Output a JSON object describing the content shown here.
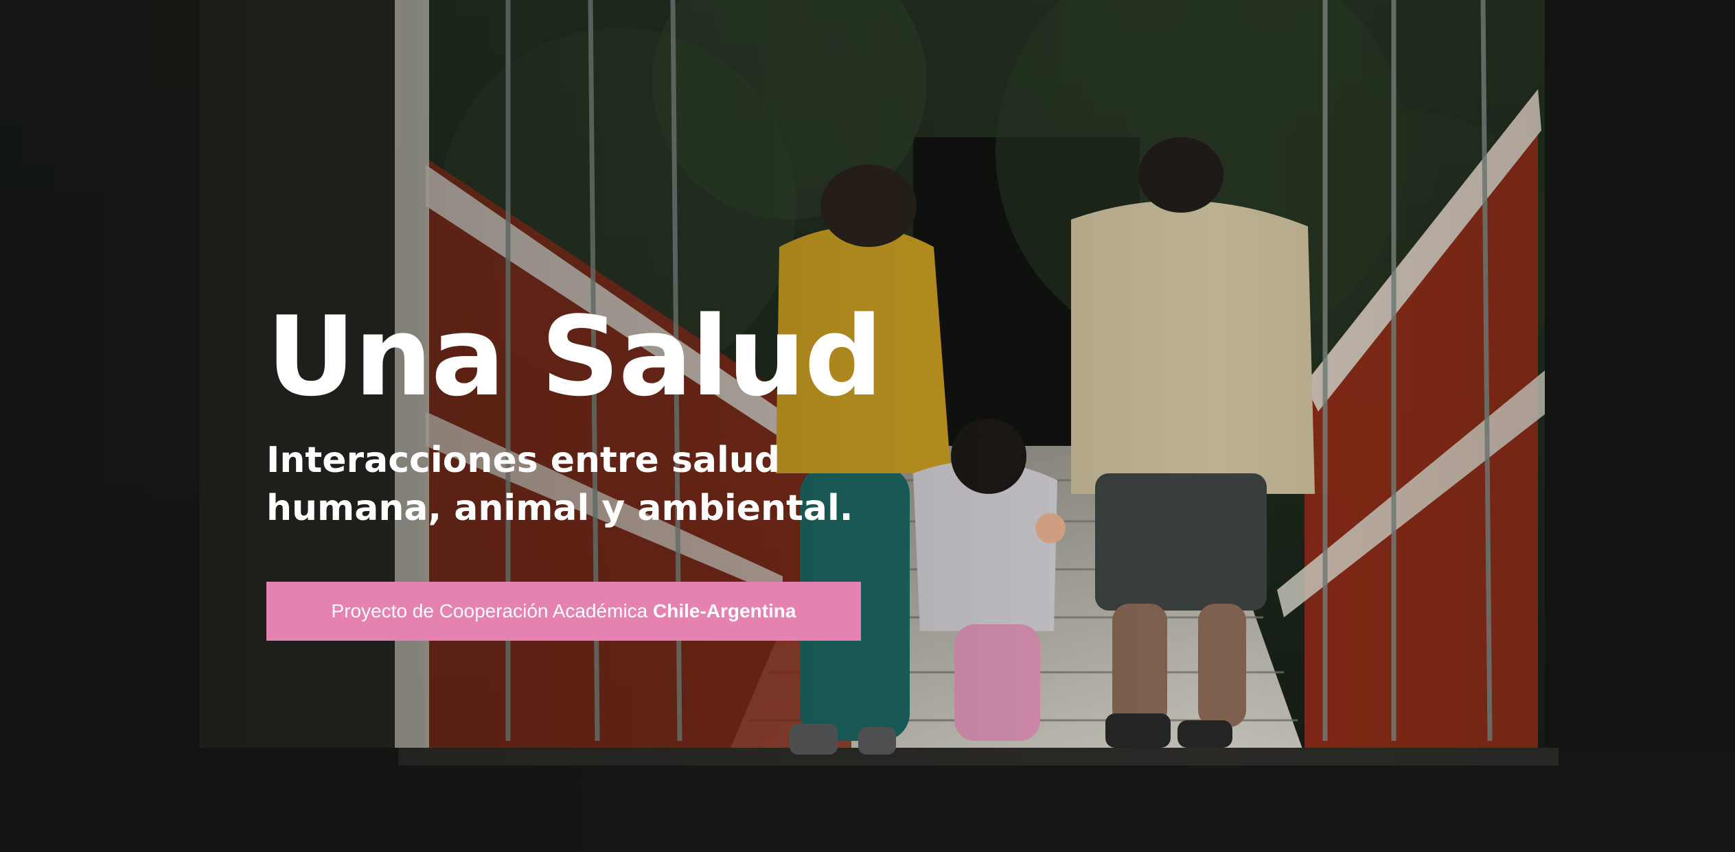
{
  "hero": {
    "title": "Una Salud",
    "subtitle_line1": "Interacciones entre salud",
    "subtitle_line2": "humana, animal y ambiental.",
    "badge_prefix": "Proyecto de Cooperación Académica",
    "badge_strong": "Chile-Argentina"
  },
  "colors": {
    "badge_background": "#e682b0",
    "text": "#ffffff"
  }
}
